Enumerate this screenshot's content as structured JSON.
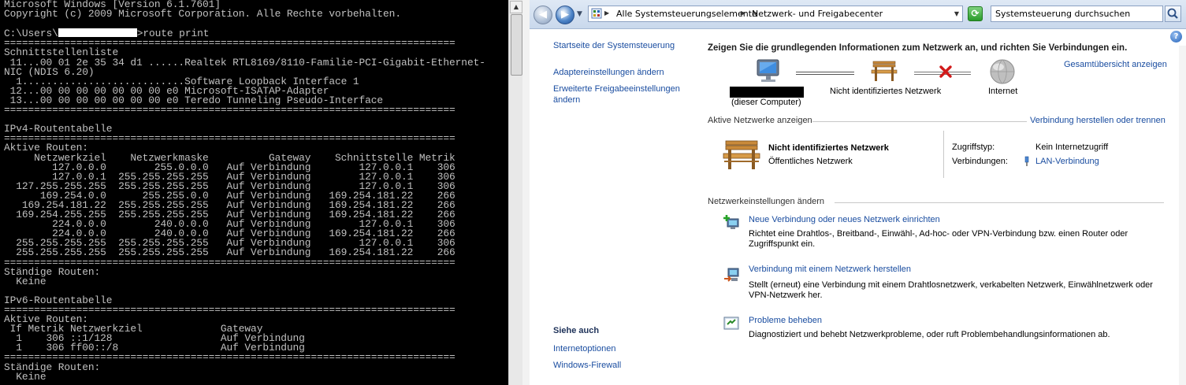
{
  "console": {
    "lines": [
      "Microsoft Windows [Version 6.1.7601]",
      "Copyright (c) 2009 Microsoft Corporation. Alle Rechte vorbehalten.",
      "",
      "C:\\Users\\",
      "===========================================================================",
      "Schnittstellenliste",
      " 11...00 01 2e 35 34 d1 ......Realtek RTL8169/8110-Familie-PCI-Gigabit-Ethernet-",
      "NIC (NDIS 6.20)",
      "  1...........................Software Loopback Interface 1",
      " 12...00 00 00 00 00 00 00 e0 Microsoft-ISATAP-Adapter",
      " 13...00 00 00 00 00 00 00 e0 Teredo Tunneling Pseudo-Interface",
      "===========================================================================",
      "",
      "IPv4-Routentabelle",
      "===========================================================================",
      "Aktive Routen:",
      "     Netzwerkziel    Netzwerkmaske          Gateway    Schnittstelle Metrik",
      "        127.0.0.0        255.0.0.0   Auf Verbindung        127.0.0.1    306",
      "        127.0.0.1  255.255.255.255   Auf Verbindung        127.0.0.1    306",
      "  127.255.255.255  255.255.255.255   Auf Verbindung        127.0.0.1    306",
      "      169.254.0.0      255.255.0.0   Auf Verbindung   169.254.181.22    266",
      "   169.254.181.22  255.255.255.255   Auf Verbindung   169.254.181.22    266",
      "  169.254.255.255  255.255.255.255   Auf Verbindung   169.254.181.22    266",
      "        224.0.0.0        240.0.0.0   Auf Verbindung        127.0.0.1    306",
      "        224.0.0.0        240.0.0.0   Auf Verbindung   169.254.181.22    266",
      "  255.255.255.255  255.255.255.255   Auf Verbindung        127.0.0.1    306",
      "  255.255.255.255  255.255.255.255   Auf Verbindung   169.254.181.22    266",
      "===========================================================================",
      "Ständige Routen:",
      "  Keine",
      "",
      "IPv6-Routentabelle",
      "===========================================================================",
      "Aktive Routen:",
      " If Metrik Netzwerkziel             Gateway",
      "  1    306 ::1/128                  Auf Verbindung",
      "  1    306 ff00::/8                 Auf Verbindung",
      "===========================================================================",
      "Ständige Routen:",
      "  Keine"
    ],
    "prompt_command": ">route print"
  },
  "explorer": {
    "breadcrumb": [
      "Alle Systemsteuerungselemente",
      "Netzwerk- und Freigabecenter"
    ],
    "search_placeholder": "Systemsteuerung durchsuchen",
    "left_links": [
      "Startseite der Systemsteuerung",
      "Adaptereinstellungen ändern",
      "Erweiterte Freigabeeinstellungen ändern"
    ],
    "see_also_title": "Siehe auch",
    "see_also_links": [
      "Internetoptionen",
      "Windows-Firewall"
    ],
    "main_heading": "Zeigen Sie die grundlegenden Informationen zum Netzwerk an, und richten Sie Verbindungen ein.",
    "full_map_link": "Gesamtübersicht anzeigen",
    "map": {
      "computer_label": "(dieser Computer)",
      "network_label": "Nicht identifiziertes Netzwerk",
      "internet_label": "Internet"
    },
    "active_networks_title": "Aktive Netzwerke anzeigen",
    "connect_link": "Verbindung herstellen oder trennen",
    "network": {
      "name": "Nicht identifiziertes Netzwerk",
      "type": "Öffentliches Netzwerk",
      "access_label": "Zugriffstyp:",
      "access_value": "Kein Internetzugriff",
      "connections_label": "Verbindungen:",
      "connections_value": "LAN-Verbindung"
    },
    "settings_title": "Netzwerkeinstellungen ändern",
    "tasks": [
      {
        "title": "Neue Verbindung oder neues Netzwerk einrichten",
        "desc": "Richtet eine Drahtlos-, Breitband-, Einwähl-, Ad-hoc- oder VPN-Verbindung bzw. einen Router oder Zugriffspunkt ein."
      },
      {
        "title": "Verbindung mit einem Netzwerk herstellen",
        "desc": "Stellt (erneut) eine Verbindung mit einem Drahtlosnetzwerk, verkabelten Netzwerk, Einwählnetzwerk oder VPN-Netzwerk her."
      },
      {
        "title": "Probleme beheben",
        "desc": "Diagnostiziert und behebt Netzwerkprobleme, oder ruft Problembehandlungsinformationen ab."
      }
    ]
  }
}
